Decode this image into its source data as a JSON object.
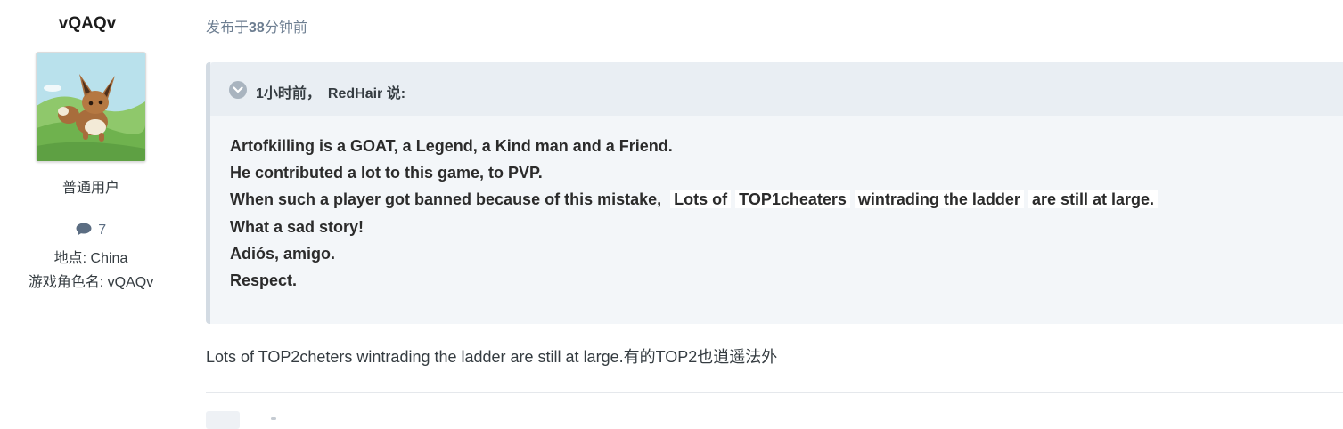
{
  "author": {
    "name": "vQAQv",
    "group": "普通用户",
    "post_count": "7",
    "location": "地点: China",
    "game_name": "游戏角色名: vQAQv"
  },
  "post": {
    "date_prefix": "发布于",
    "date_value": "38",
    "date_suffix": "分钟前",
    "quote": {
      "time": "1小时前，",
      "author": "RedHair",
      "said": "说:",
      "lines": {
        "l1": "Artofkilling is a GOAT, a Legend, a Kind man and a Friend.",
        "l2": "He contributed a lot to this game, to PVP.",
        "l3_a": "When such a player got banned because of this mistake,",
        "l3_b": "Lots of",
        "l3_c": "TOP1cheaters",
        "l3_d": "wintrading the ladder",
        "l3_e": "are still at large.",
        "l4": "What a sad story!",
        "l5": "Adiós, amigo.",
        "l6": "Respect."
      }
    },
    "text": "Lots of TOP2cheters wintrading the ladder are still at large.有的TOP2也逍遥法外"
  },
  "icons": {
    "comment": "comment-icon",
    "toggle": "chevron-down-icon"
  },
  "colors": {
    "quote_bg": "#f3f6f9",
    "quote_header_bg": "#e9eef3",
    "quote_border": "#d3dbe3",
    "meta_text": "#6d7e91"
  }
}
